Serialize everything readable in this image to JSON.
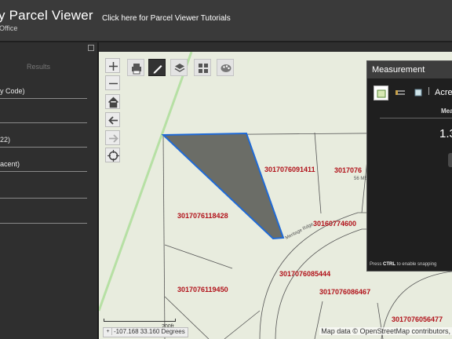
{
  "header": {
    "title": "y Parcel Viewer",
    "subtitle": "Office",
    "tutorial_link": "Click here for Parcel Viewer Tutorials"
  },
  "side_panel": {
    "tab_label": "Results",
    "rows": [
      {
        "label": "y Code)"
      },
      {
        "label": ""
      },
      {
        "label": "22)"
      },
      {
        "label": "acent)"
      },
      {
        "label": ""
      },
      {
        "label": ""
      }
    ]
  },
  "map": {
    "parcels": [
      {
        "id": "3017076091411"
      },
      {
        "id": "3017076"
      },
      {
        "id": "3017076118428"
      },
      {
        "id": "30160774600"
      },
      {
        "id": "3017076085444"
      },
      {
        "id": "3017076119450"
      },
      {
        "id": "3017076086467"
      },
      {
        "id": "3017076056477"
      }
    ],
    "road_labels": [
      "Meritage Rdge",
      "56 ME"
    ],
    "scale_label": "200ft",
    "coordinates": "-107.168 33.160 Degrees",
    "attribution": "Map data © OpenStreetMap contributors,",
    "parcel_fill_color": "#6b6d67",
    "selection_outline_color": "#1f6ad6"
  },
  "tools": {
    "zoom_in": "zoom-in",
    "zoom_out": "zoom-out",
    "home": "home",
    "back": "previous-extent",
    "forward": "next-extent",
    "locate": "locate",
    "print": "print",
    "draw": "draw",
    "layers": "layers",
    "basemap": "basemap-gallery",
    "palette": "symbology"
  },
  "measurement": {
    "title": "Measurement",
    "unit": "Acre",
    "result_label": "Mea",
    "value": "1.3",
    "hint_prefix": "Press ",
    "hint_key": "CTRL",
    "hint_suffix": " to enable snapping"
  },
  "colors": {
    "header_bg": "#3a3a3a",
    "panel_bg": "#2f2f2f",
    "map_bg": "#e8ecde",
    "parcel_label": "#b1121a"
  }
}
